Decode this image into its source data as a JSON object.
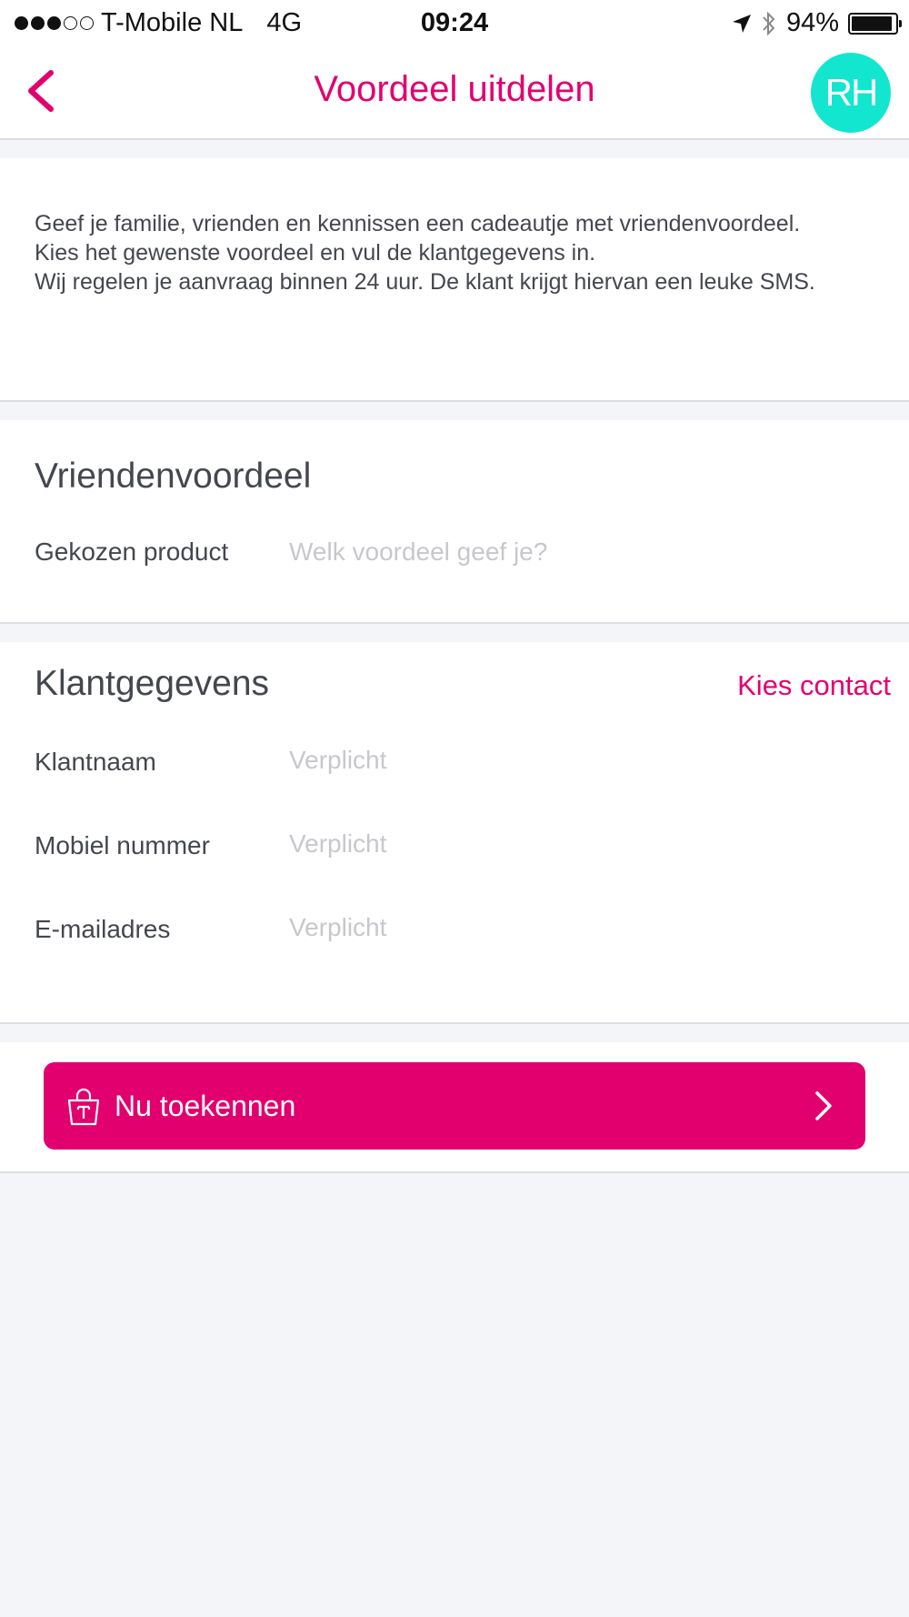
{
  "status_bar": {
    "carrier": "T-Mobile NL",
    "network": "4G",
    "time": "09:24",
    "battery": "94%",
    "battery_level": 0.94
  },
  "nav": {
    "title": "Voordeel uitdelen",
    "avatar_initials": "RH"
  },
  "intro": {
    "line1": "Geef je familie, vrienden en kennissen een cadeautje met vriendenvoordeel.",
    "line2": "Kies het gewenste voordeel en vul de klantgegevens in.",
    "line3": "Wij regelen je aanvraag binnen 24 uur. De klant krijgt hiervan een leuke SMS."
  },
  "product_section": {
    "title": "Vriendenvoordeel",
    "field_label": "Gekozen product",
    "field_placeholder": "Welk voordeel geef je?"
  },
  "customer_section": {
    "title": "Klantgegevens",
    "action": "Kies contact",
    "fields": [
      {
        "label": "Klantnaam",
        "placeholder": "Verplicht"
      },
      {
        "label": "Mobiel nummer",
        "placeholder": "Verplicht"
      },
      {
        "label": "E-mailadres",
        "placeholder": "Verplicht"
      }
    ]
  },
  "cta": {
    "label": "Nu toekennen"
  },
  "colors": {
    "brand": "#e2006f",
    "avatar": "#12e6cf",
    "background": "#f4f5f9"
  }
}
